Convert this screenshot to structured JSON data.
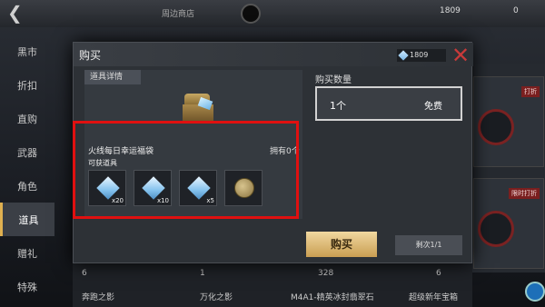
{
  "topbar": {
    "back_icon": "back-arrow-icon",
    "center_text": "周边商店",
    "currency_1": "1809",
    "currency_2": "0"
  },
  "sidebar": {
    "items": [
      {
        "label": "黑市"
      },
      {
        "label": "折扣"
      },
      {
        "label": "直购"
      },
      {
        "label": "武器"
      },
      {
        "label": "角色"
      },
      {
        "label": "道具",
        "active": true
      },
      {
        "label": "赠礼"
      },
      {
        "label": "特殊"
      }
    ]
  },
  "right_cards": [
    {
      "tag": "打折"
    },
    {
      "tag": "限时打折"
    }
  ],
  "bottom_row": {
    "counts": [
      "6",
      "1",
      "328",
      "6"
    ],
    "names": [
      "奔跑之影",
      "万化之影",
      "M4A1-精英冰封翡翠石",
      "超级新年宝箱"
    ]
  },
  "modal": {
    "title": "购买",
    "balance": "1809",
    "close_icon": "close-x-icon",
    "details_tab": "道具详情",
    "product_name": "火线每日幸运福袋",
    "owned": "拥有0个",
    "obtainable_label": "可获道具",
    "items": [
      {
        "icon": "diamond-icon",
        "qty": "x20"
      },
      {
        "icon": "diamond-icon",
        "qty": "x10"
      },
      {
        "icon": "diamond-icon",
        "qty": "x5"
      },
      {
        "icon": "coin-icon",
        "qty": ""
      }
    ],
    "quantity_label": "购买数量",
    "quantity_value": "1个",
    "price": "免费",
    "buy_button": "购买",
    "count_button": "剩次1/1"
  },
  "colors": {
    "highlight_border": "#e01010",
    "buy_button": "#d9b56f",
    "close": "#c83a3a"
  }
}
